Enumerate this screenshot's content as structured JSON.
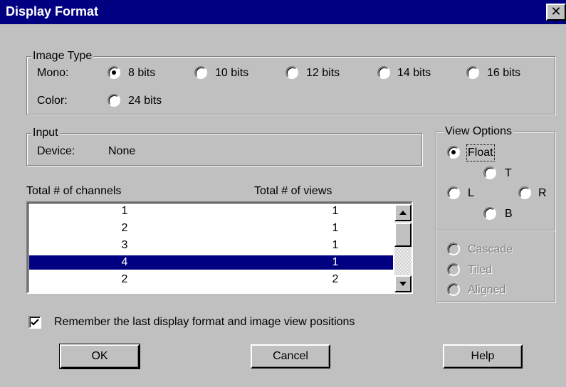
{
  "window": {
    "title": "Display Format",
    "close_label": "✕"
  },
  "image_type": {
    "legend": "Image Type",
    "mono_label": "Mono:",
    "color_label": "Color:",
    "mono_options": [
      "8 bits",
      "10 bits",
      "12 bits",
      "14 bits",
      "16 bits"
    ],
    "mono_selected": "8 bits",
    "color_options": [
      "24 bits"
    ]
  },
  "input": {
    "legend": "Input",
    "device_label": "Device:",
    "device_value": "None"
  },
  "channels": {
    "col1_header": "Total # of channels",
    "col2_header": "Total # of views",
    "rows": [
      {
        "channels": "1",
        "views": "1",
        "selected": false
      },
      {
        "channels": "2",
        "views": "1",
        "selected": false
      },
      {
        "channels": "3",
        "views": "1",
        "selected": false
      },
      {
        "channels": "4",
        "views": "1",
        "selected": true
      },
      {
        "channels": "2",
        "views": "2",
        "selected": false
      }
    ]
  },
  "view_options": {
    "legend": "View Options",
    "float": "Float",
    "t": "T",
    "l": "L",
    "r": "R",
    "b": "B",
    "cascade": "Cascade",
    "tiled": "Tiled",
    "aligned": "Aligned",
    "selected": "Float"
  },
  "remember": {
    "label": "Remember the last display format and image view positions",
    "checked": true
  },
  "buttons": {
    "ok": "OK",
    "cancel": "Cancel",
    "help": "Help"
  }
}
